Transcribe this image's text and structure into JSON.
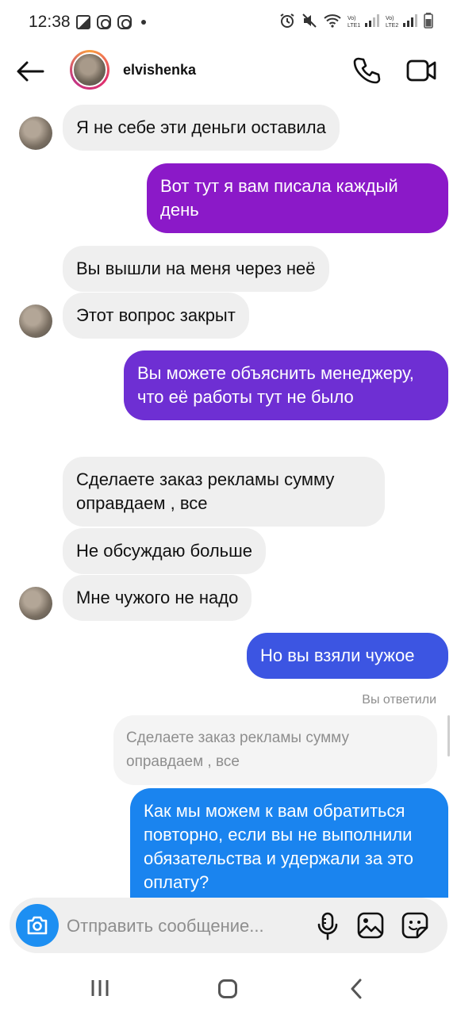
{
  "status_bar": {
    "time": "12:38",
    "left_icons": [
      "gallery-icon",
      "instagram-icon",
      "instagram-icon",
      "dot-icon"
    ],
    "right_icons": [
      "alarm-icon",
      "mute-icon",
      "wifi-icon",
      "signal-sim1-icon",
      "signal-sim2-icon",
      "battery-icon"
    ],
    "sim1_label": "Vo) LTE1",
    "sim2_label": "Vo) LTE2"
  },
  "header": {
    "username": "elvishenka",
    "back_icon": "arrow-left-icon",
    "call_icon": "phone-icon",
    "video_icon": "video-camera-icon"
  },
  "messages": [
    {
      "direction": "in",
      "text": "Я не себе эти деньги оставила"
    },
    {
      "direction": "out",
      "text": "Вот тут я вам писала каждый день"
    },
    {
      "direction": "in",
      "text": "Вы вышли на меня через неё"
    },
    {
      "direction": "in",
      "text": "Этот вопрос закрыт"
    },
    {
      "direction": "out",
      "text": "Вы можете объяснить менеджеру, что её работы тут не было"
    },
    {
      "direction": "in",
      "text": "Сделаете заказ рекламы сумму оправдаем , все"
    },
    {
      "direction": "in",
      "text": "Не обсуждаю больше"
    },
    {
      "direction": "in",
      "text": "Мне чужого не надо"
    },
    {
      "direction": "out",
      "text": "Но вы взяли чужое"
    },
    {
      "direction": "out",
      "text": "Как мы можем к вам обратиться повторно, если вы не выполнили обязательства и удержали за это оплату?"
    }
  ],
  "reply": {
    "label": "Вы ответили",
    "quoted_text": "Сделаете заказ рекламы сумму оправдаем , все"
  },
  "composer": {
    "placeholder": "Отправить сообщение...",
    "camera_icon": "camera-icon",
    "mic_icon": "microphone-icon",
    "gallery_icon": "gallery-icon",
    "sticker_icon": "sticker-icon"
  },
  "colors": {
    "incoming_bubble": "#efefef",
    "out_gradient_top": "#8b19c8",
    "out_gradient_bottom": "#1a84ef",
    "camera_button": "#1d8ff2"
  },
  "nav_bar": {
    "icons": [
      "recents-icon",
      "home-icon",
      "back-icon"
    ]
  }
}
